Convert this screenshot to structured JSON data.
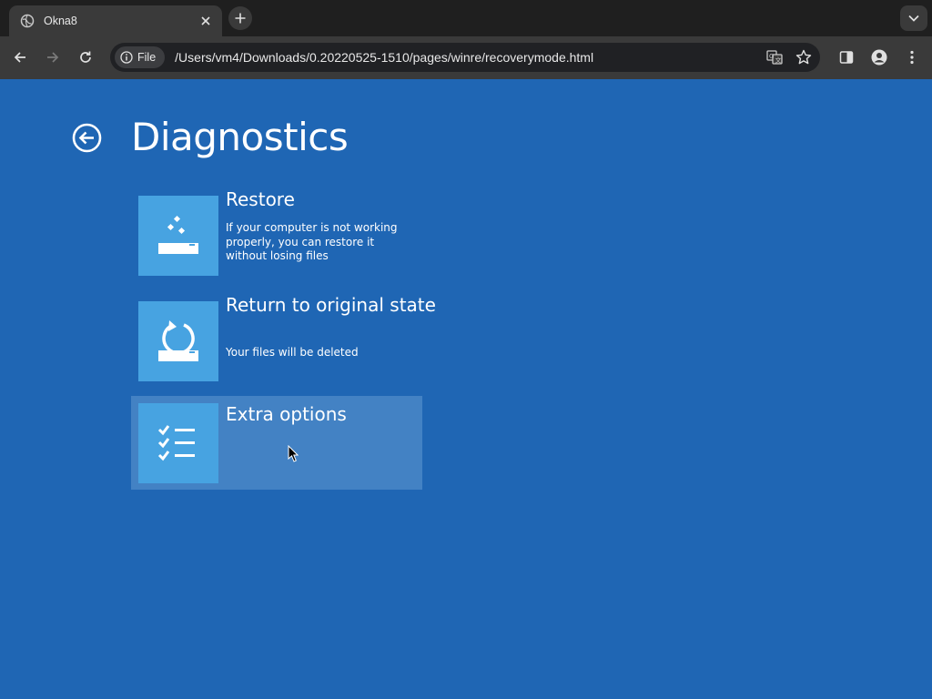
{
  "browser": {
    "tab": {
      "title": "Okna8"
    },
    "address_bar": {
      "chip_label": "File",
      "url": "/Users/vm4/Downloads/0.20220525-1510/pages/winre/recoverymode.html"
    }
  },
  "page": {
    "title": "Diagnostics",
    "options": [
      {
        "title": "Restore",
        "description": "If your computer is not working properly, you can restore it without losing files",
        "icon": "restore-icon"
      },
      {
        "title": "Return to original state",
        "description": "Your files will be deleted",
        "icon": "reset-icon"
      },
      {
        "title": "Extra options",
        "description": "",
        "icon": "checklist-icon",
        "highlighted": true
      }
    ]
  },
  "colors": {
    "background": "#1f66b4",
    "tile": "#47a3e1",
    "highlight": "#4382c4",
    "chrome_dark": "#1f1f1f",
    "chrome_toolbar": "#3a3a3a"
  }
}
